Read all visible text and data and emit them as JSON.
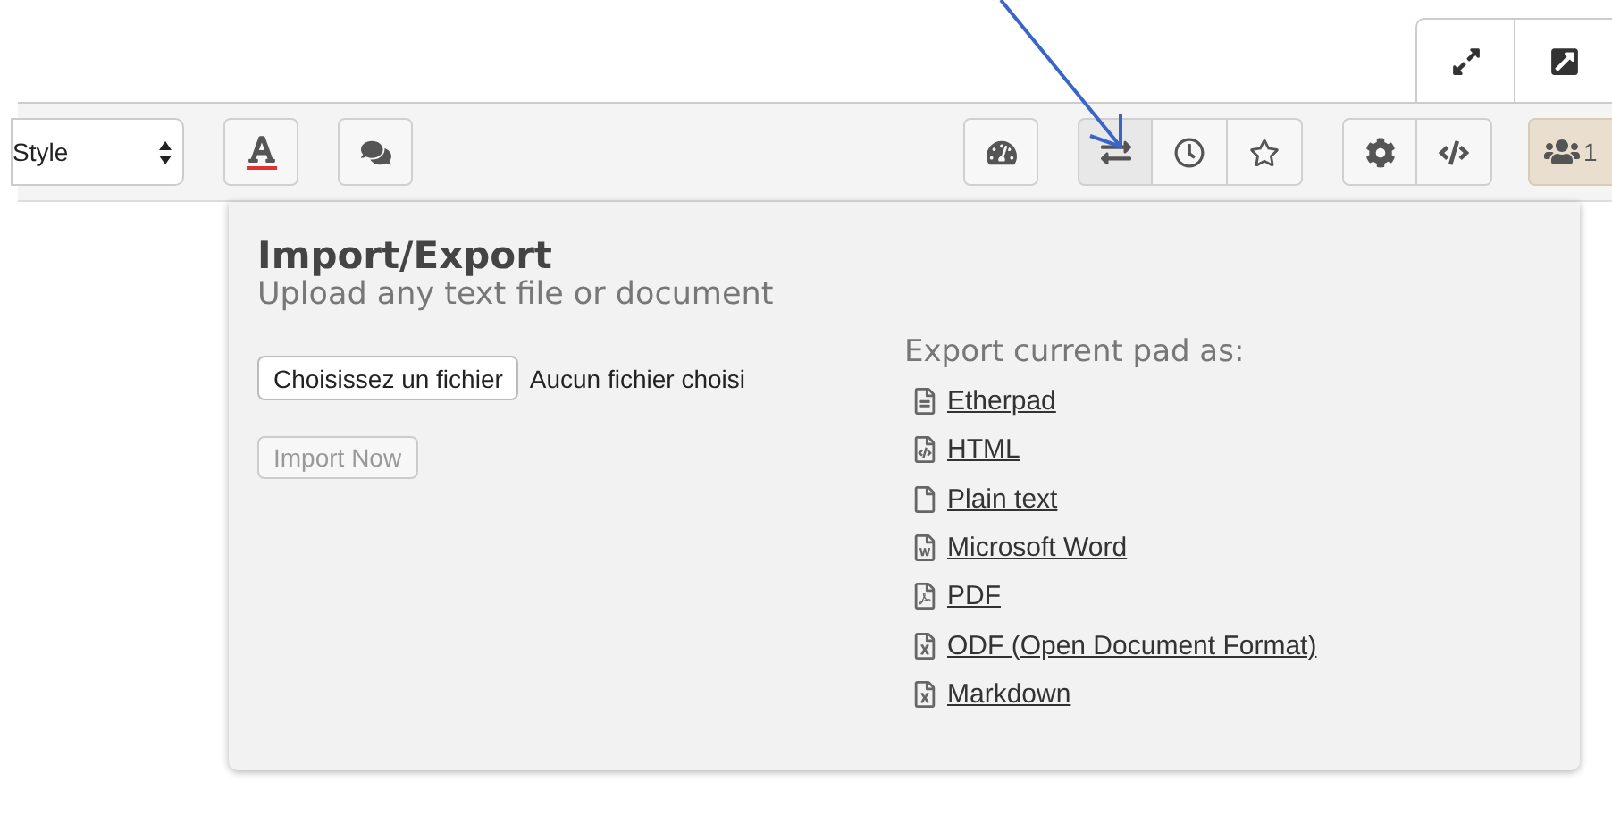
{
  "top_buttons": [
    {
      "kind": "expand"
    },
    {
      "kind": "popout"
    }
  ],
  "toolbar": {
    "style_select": {
      "value": "Style"
    },
    "left_buttons": [
      {
        "kind": "font-color"
      },
      {
        "kind": "chat"
      }
    ],
    "right_groups": [
      [
        {
          "kind": "dashboard",
          "selected": false
        }
      ],
      [
        {
          "kind": "import-export",
          "selected": true
        },
        {
          "kind": "history",
          "selected": false
        },
        {
          "kind": "star",
          "selected": false
        }
      ],
      [
        {
          "kind": "settings",
          "selected": false
        },
        {
          "kind": "embed",
          "selected": false
        }
      ]
    ],
    "users": {
      "count": "1"
    }
  },
  "panel": {
    "title": "Import/Export",
    "subtitle": "Upload any text file or document",
    "file_button": "Choisissez un fichier",
    "file_status": "Aucun fichier choisi",
    "import_button": "Import Now",
    "import_disabled": true,
    "export_heading": "Export current pad as:",
    "export_links": [
      {
        "label": "Etherpad",
        "kind": "etherpad"
      },
      {
        "label": "HTML",
        "kind": "html"
      },
      {
        "label": "Plain text",
        "kind": "text"
      },
      {
        "label": "Microsoft Word",
        "kind": "word"
      },
      {
        "label": "PDF",
        "kind": "pdf"
      },
      {
        "label": "ODF (Open Document Format)",
        "kind": "odf"
      },
      {
        "label": "Markdown",
        "kind": "markdown"
      }
    ]
  },
  "annotation_arrow": true
}
